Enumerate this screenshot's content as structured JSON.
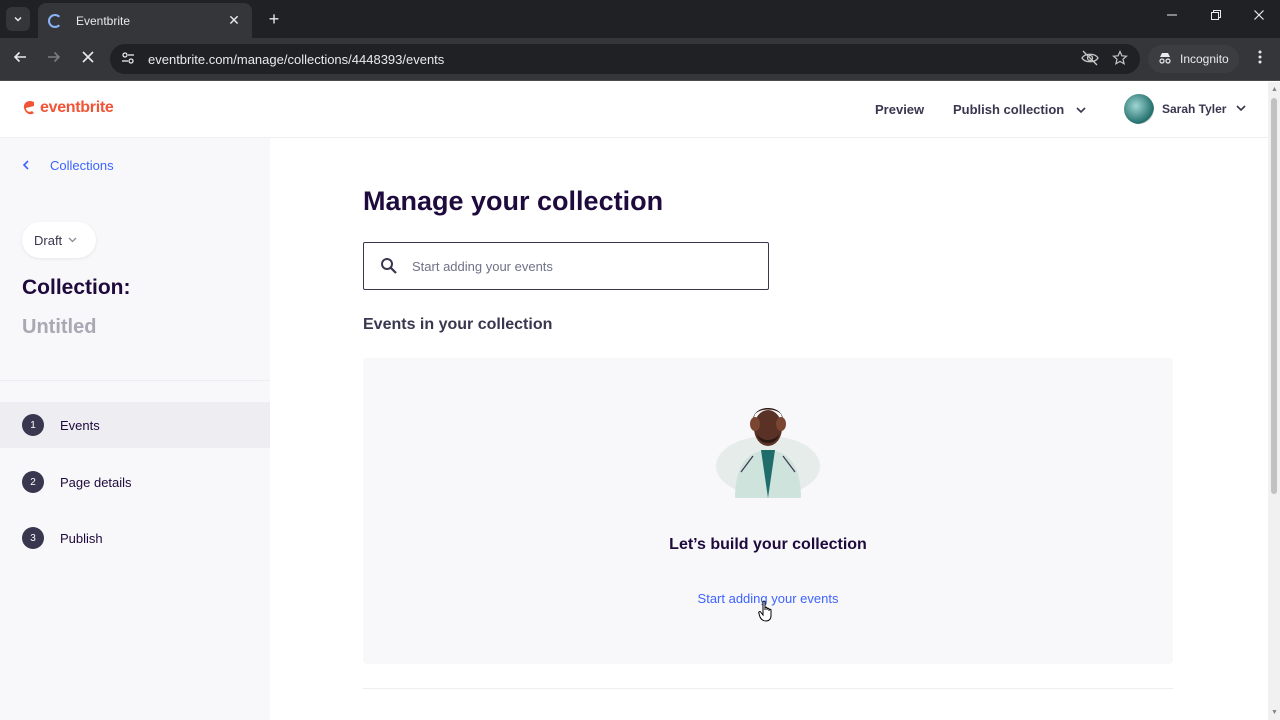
{
  "browser": {
    "tab_title": "Eventbrite",
    "tab_close": "✕",
    "new_tab": "+",
    "url": "eventbrite.com/manage/collections/4448393/events",
    "incognito_label": "Incognito",
    "icons": [
      "chevron-down-icon",
      "back-arrow-icon",
      "forward-arrow-icon",
      "stop-loading-icon",
      "site-info-icon",
      "eye-off-icon",
      "star-icon",
      "incognito-icon",
      "menu-dots-icon",
      "minimize-icon",
      "restore-icon",
      "close-window-icon"
    ]
  },
  "header": {
    "logo_text": "eventbrite",
    "preview": "Preview",
    "publish": "Publish collection",
    "user_name": "Sarah Tyler"
  },
  "sidebar": {
    "back_label": "Collections",
    "status": "Draft",
    "collection_label": "Collection:",
    "collection_name": "Untitled",
    "steps": [
      {
        "num": "1",
        "label": "Events",
        "active": true
      },
      {
        "num": "2",
        "label": "Page details",
        "active": false
      },
      {
        "num": "3",
        "label": "Publish",
        "active": false
      }
    ]
  },
  "main": {
    "title": "Manage your collection",
    "search_placeholder": "Start adding your events",
    "section_title": "Events in your collection",
    "empty_title": "Let’s build your collection",
    "empty_link": "Start adding your events"
  },
  "colors": {
    "brand": "#f05537",
    "link": "#3d64ff",
    "text": "#1e0a3c",
    "sidebar_bg": "#f8f7fa"
  }
}
